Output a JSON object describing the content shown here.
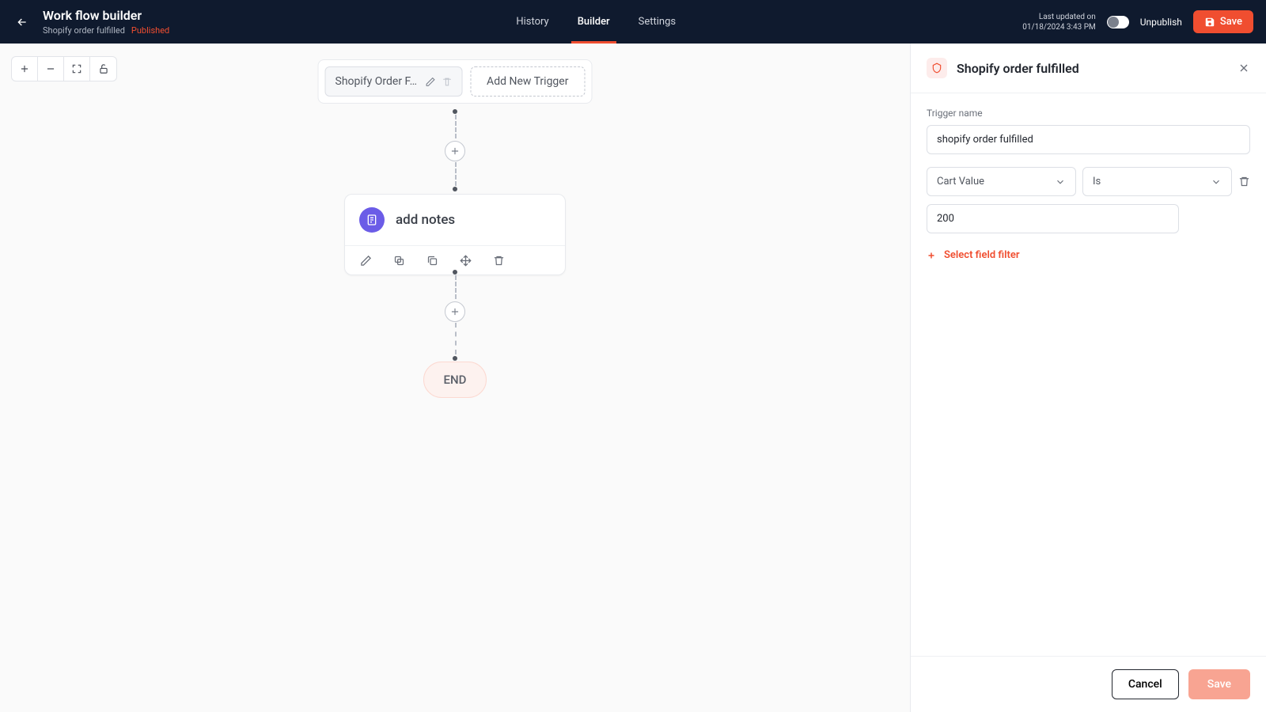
{
  "header": {
    "title": "Work flow builder",
    "workflow_name": "Shopify order fulfilled",
    "status": "Published",
    "tabs": {
      "history": "History",
      "builder": "Builder",
      "settings": "Settings"
    },
    "updated_label": "Last updated on",
    "updated_value": "01/18/2024 3:43 PM",
    "unpublish_label": "Unpublish",
    "save_label": "Save"
  },
  "canvas": {
    "trigger_chip": "Shopify Order F…",
    "add_trigger": "Add New Trigger",
    "action_title": "add notes",
    "end_label": "END"
  },
  "panel": {
    "title": "Shopify order fulfilled",
    "trigger_name_label": "Trigger name",
    "trigger_name_value": "shopify order fulfilled",
    "filter_field": "Cart Value",
    "filter_op": "Is",
    "filter_value": "200",
    "add_filter_label": "Select field filter",
    "cancel_label": "Cancel",
    "save_label": "Save"
  }
}
